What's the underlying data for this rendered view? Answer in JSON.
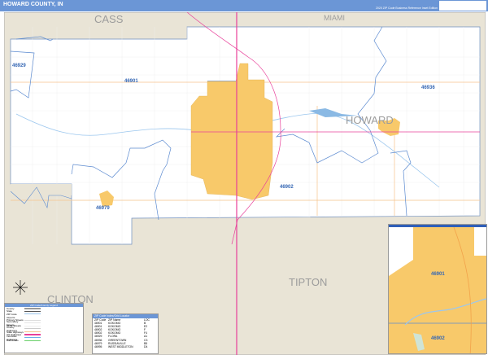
{
  "header": {
    "title": "HOWARD COUNTY, IN",
    "edition": "2020 ZIP Code Business Reference Inset Edition",
    "logo": "MARKET MAPS"
  },
  "map": {
    "county_name": "HOWARD",
    "neighbors": [
      "CASS",
      "MIAMI",
      "TIPTON",
      "CLINTON"
    ],
    "zip_labels": [
      "46929",
      "46901",
      "46936",
      "46902",
      "46979"
    ],
    "colors": {
      "county_fill": "#ffffff",
      "outside_fill": "#e9e4d6",
      "urban_fill": "#f8c96a",
      "zip_boundary": "#5b8ad0",
      "water": "#9cc7ee",
      "us_highway": "#e8409a",
      "state_road": "#f6c38c"
    }
  },
  "compass": {
    "icon": "compass-rose-icon"
  },
  "legend": {
    "title": "ZIP Code/County Legend",
    "items": [
      "County",
      "State",
      "ZIP Code",
      "Airports",
      "Primary Streets",
      "Secondary Streets",
      "Minor Streets",
      "County Highways",
      "State Highways",
      "US Highways",
      "Interstate Highways",
      "Rail Roads"
    ]
  },
  "index": {
    "title": "ZIP Code Index/Grid Locator",
    "columns": [
      "ZIP Code",
      "ZIP Name",
      "LOC"
    ],
    "rows": [
      [
        "46901",
        "KOKOMO",
        "B"
      ],
      [
        "46901",
        "KOKOMO",
        "E2"
      ],
      [
        "46902",
        "KOKOMO",
        "F"
      ],
      [
        "46902",
        "KOKOMO",
        "F4"
      ],
      [
        "46929",
        "FLORA",
        "A1"
      ],
      [
        "46936",
        "GREENTOWN",
        "C3"
      ],
      [
        "46979",
        "RUSSIAVILLE",
        "B5"
      ],
      [
        "46995",
        "WEST MIDDLETON",
        "D4"
      ]
    ]
  },
  "inset": {
    "zip_labels": [
      "46901",
      "46902"
    ]
  }
}
